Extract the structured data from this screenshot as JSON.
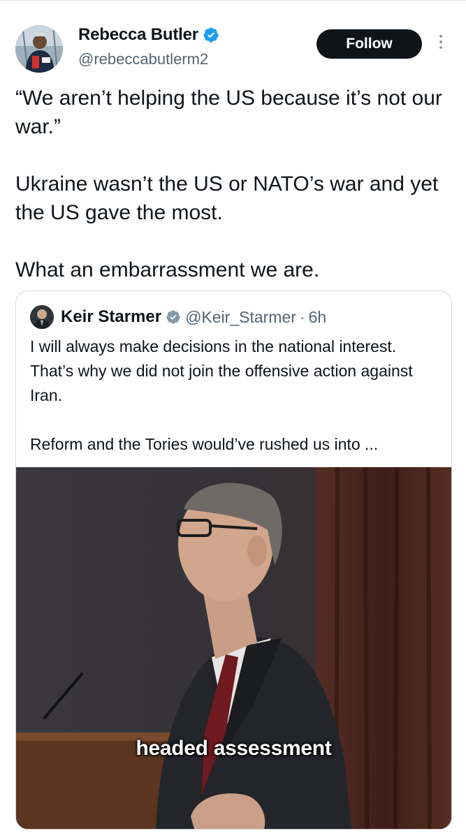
{
  "author": {
    "name": "Rebecca Butler",
    "handle": "@rebeccabutlerm2",
    "verified": true
  },
  "actions": {
    "follow_label": "Follow"
  },
  "tweet": {
    "paragraphs": [
      "“We aren’t helping the US because it’s not our war.”",
      "Ukraine wasn’t the US or NATO’s war and yet the US gave the most.",
      "What an embarrassment we are."
    ]
  },
  "quote": {
    "name": "Keir Starmer",
    "handle": "@Keir_Starmer",
    "separator": "·",
    "time": "6h",
    "verified": true,
    "paragraphs": [
      "I will always make decisions in the national interest. That’s why we did not join the offensive action against Iran.",
      "Reform and the Tories would’ve rushed us into ..."
    ],
    "media": {
      "caption": "headed assessment"
    }
  },
  "colors": {
    "verified": "#1d9bf0",
    "follow_bg": "#0f1419",
    "secondary_text": "#536471"
  }
}
